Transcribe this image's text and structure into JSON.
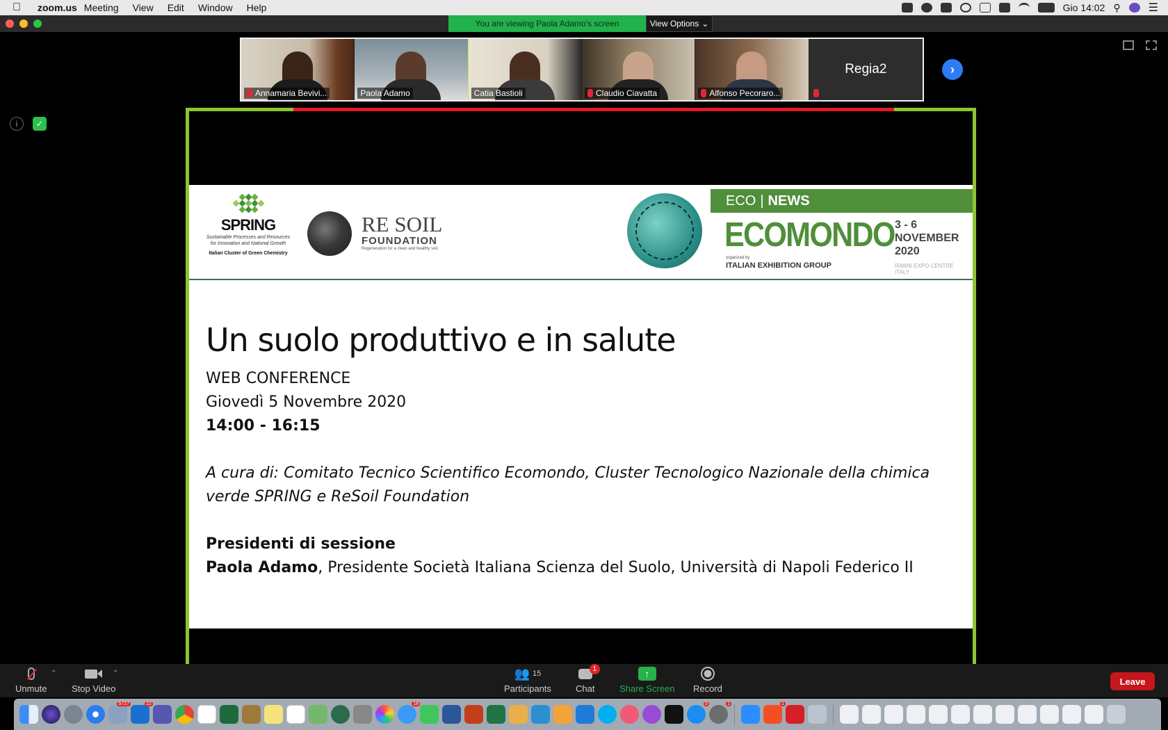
{
  "menubar": {
    "app_name": "zoom.us",
    "items": [
      "Meeting",
      "View",
      "Edit",
      "Window",
      "Help"
    ],
    "clock": "Gio 14:02"
  },
  "banner": {
    "viewing_text": "You are viewing Paola Adamo's screen",
    "view_options": "View Options"
  },
  "participants_strip": {
    "tiles": [
      {
        "name": "Annamaria Bevivi...",
        "muted": true
      },
      {
        "name": "Paola Adamo",
        "muted": false,
        "active": true
      },
      {
        "name": "Catia Bastioli",
        "muted": false
      },
      {
        "name": "Claudio Ciavatta",
        "muted": true
      },
      {
        "name": "Alfonso Pecoraro...",
        "muted": true
      },
      {
        "name": "Regia2",
        "muted": true,
        "video_off": true
      }
    ]
  },
  "slide": {
    "spring": {
      "word": "SPRING",
      "tagline_1": "Sustainable Processes and Resources",
      "tagline_2": "for Innovation and National Growth",
      "tagline_3": "Italian Cluster of Green Chemistry"
    },
    "resoil": {
      "line1": "RE SOIL",
      "line2": "FOUNDATION",
      "line3": "Regeneration for a clean and healthy soil."
    },
    "ecomondo": {
      "band_eco": "ECO",
      "band_sep": "|",
      "band_news": "NEWS",
      "title": "ECOMONDO",
      "organized": "organized by",
      "ieg": "ITALIAN EXHIBITION GROUP",
      "dates_1": "3 - 6",
      "dates_2": "NOVEMBER",
      "dates_3": "2020",
      "venue_1": "RIMINI EXPO CENTRE",
      "venue_2": "ITALY"
    },
    "title": "Un suolo produttivo e in salute",
    "subtitle": "WEB CONFERENCE",
    "date": "Giovedì 5 Novembre 2020",
    "time": "14:00 - 16:15",
    "curated_line_1": "A cura di: Comitato Tecnico Scientifico Ecomondo, Cluster Tecnologico Nazionale della chimica",
    "curated_line_2": "verde SPRING e ReSoil Foundation",
    "presidents_heading": "Presidenti di sessione",
    "president_name": "Paola Adamo",
    "president_role": ", Presidente Società Italiana Scienza del Suolo, Università di Napoli Federico II"
  },
  "controls": {
    "unmute": "Unmute",
    "stop_video": "Stop Video",
    "participants": "Participants",
    "participants_count": "15",
    "chat": "Chat",
    "chat_badge": "1",
    "share_screen": "Share Screen",
    "record": "Record",
    "leave": "Leave"
  },
  "colors": {
    "share_border": "#8ec431",
    "banner_green": "#22b14c",
    "leave_red": "#c4161c",
    "eco_green": "#4f8f3b"
  },
  "dock": {
    "badges": {
      "mail": "5727",
      "outlook": "22",
      "messages": "18",
      "app_store": "5",
      "pages": "1",
      "preferences": "1"
    }
  }
}
